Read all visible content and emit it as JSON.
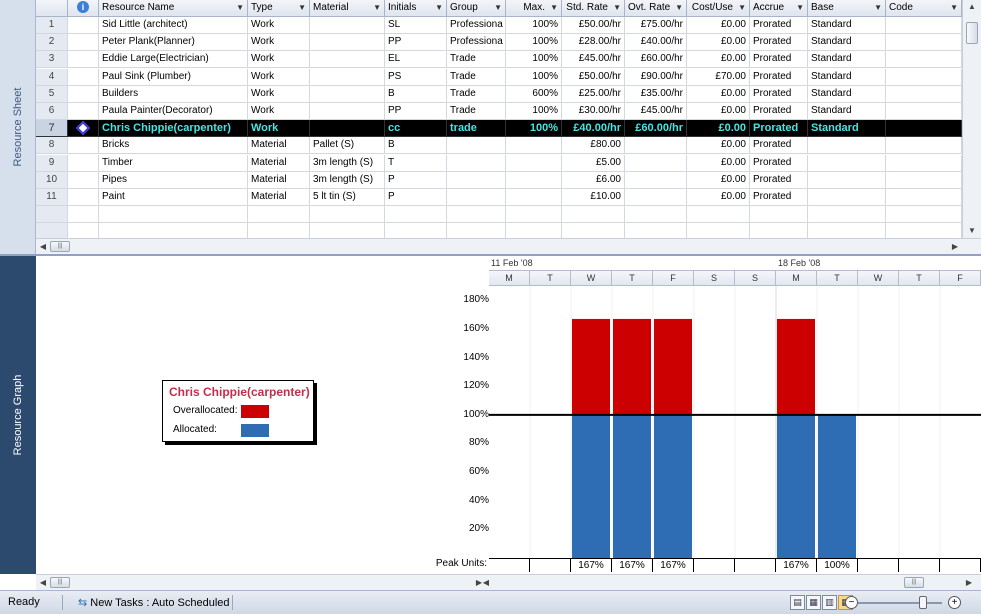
{
  "sheet": {
    "sidebar_label": "Resource Sheet",
    "columns": [
      {
        "key": "num",
        "label": ""
      },
      {
        "key": "ind",
        "label": "i-icon"
      },
      {
        "key": "name",
        "label": "Resource Name"
      },
      {
        "key": "type",
        "label": "Type"
      },
      {
        "key": "material",
        "label": "Material"
      },
      {
        "key": "initials",
        "label": "Initials"
      },
      {
        "key": "group",
        "label": "Group"
      },
      {
        "key": "max",
        "label": "Max."
      },
      {
        "key": "std",
        "label": "Std. Rate"
      },
      {
        "key": "ovt",
        "label": "Ovt. Rate"
      },
      {
        "key": "cost",
        "label": "Cost/Use"
      },
      {
        "key": "accrue",
        "label": "Accrue"
      },
      {
        "key": "base",
        "label": "Base"
      },
      {
        "key": "code",
        "label": "Code"
      }
    ],
    "rows": [
      {
        "num": "1",
        "name": "Sid Little (architect)",
        "type": "Work",
        "material": "",
        "initials": "SL",
        "group": "Professiona",
        "max": "100%",
        "std": "£50.00/hr",
        "ovt": "£75.00/hr",
        "cost": "£0.00",
        "accrue": "Prorated",
        "base": "Standard",
        "code": ""
      },
      {
        "num": "2",
        "name": "Peter Plank(Planner)",
        "type": "Work",
        "material": "",
        "initials": "PP",
        "group": "Professiona",
        "max": "100%",
        "std": "£28.00/hr",
        "ovt": "£40.00/hr",
        "cost": "£0.00",
        "accrue": "Prorated",
        "base": "Standard",
        "code": ""
      },
      {
        "num": "3",
        "name": "Eddie Large(Electrician)",
        "type": "Work",
        "material": "",
        "initials": "EL",
        "group": "Trade",
        "max": "100%",
        "std": "£45.00/hr",
        "ovt": "£60.00/hr",
        "cost": "£0.00",
        "accrue": "Prorated",
        "base": "Standard",
        "code": ""
      },
      {
        "num": "4",
        "name": "Paul Sink (Plumber)",
        "type": "Work",
        "material": "",
        "initials": "PS",
        "group": "Trade",
        "max": "100%",
        "std": "£50.00/hr",
        "ovt": "£90.00/hr",
        "cost": "£70.00",
        "accrue": "Prorated",
        "base": "Standard",
        "code": ""
      },
      {
        "num": "5",
        "name": "Builders",
        "type": "Work",
        "material": "",
        "initials": "B",
        "group": "Trade",
        "max": "600%",
        "std": "£25.00/hr",
        "ovt": "£35.00/hr",
        "cost": "£0.00",
        "accrue": "Prorated",
        "base": "Standard",
        "code": ""
      },
      {
        "num": "6",
        "name": "Paula Painter(Decorator)",
        "type": "Work",
        "material": "",
        "initials": "PP",
        "group": "Trade",
        "max": "100%",
        "std": "£30.00/hr",
        "ovt": "£45.00/hr",
        "cost": "£0.00",
        "accrue": "Prorated",
        "base": "Standard",
        "code": ""
      },
      {
        "num": "7",
        "name": "Chris Chippie(carpenter)",
        "type": "Work",
        "material": "",
        "initials": "cc",
        "group": "trade",
        "max": "100%",
        "std": "£40.00/hr",
        "ovt": "£60.00/hr",
        "cost": "£0.00",
        "accrue": "Prorated",
        "base": "Standard",
        "code": "",
        "selected": true
      },
      {
        "num": "8",
        "name": "Bricks",
        "type": "Material",
        "material": "Pallet (S)",
        "initials": "B",
        "group": "",
        "max": "",
        "std": "£80.00",
        "ovt": "",
        "cost": "£0.00",
        "accrue": "Prorated",
        "base": "",
        "code": ""
      },
      {
        "num": "9",
        "name": "Timber",
        "type": "Material",
        "material": "3m length (S)",
        "initials": "T",
        "group": "",
        "max": "",
        "std": "£5.00",
        "ovt": "",
        "cost": "£0.00",
        "accrue": "Prorated",
        "base": "",
        "code": ""
      },
      {
        "num": "10",
        "name": "Pipes",
        "type": "Material",
        "material": "3m length (S)",
        "initials": "P",
        "group": "",
        "max": "",
        "std": "£6.00",
        "ovt": "",
        "cost": "£0.00",
        "accrue": "Prorated",
        "base": "",
        "code": ""
      },
      {
        "num": "11",
        "name": "Paint",
        "type": "Material",
        "material": "5 lt tin (S)",
        "initials": "P",
        "group": "",
        "max": "",
        "std": "£10.00",
        "ovt": "",
        "cost": "£0.00",
        "accrue": "Prorated",
        "base": "",
        "code": ""
      }
    ]
  },
  "graph": {
    "sidebar_label": "Resource Graph",
    "legend": {
      "title": "Chris Chippie(carpenter)",
      "overallocated_label": "Overallocated:",
      "allocated_label": "Allocated:",
      "overallocated_color": "#cc0000",
      "allocated_color": "#2e6db4"
    },
    "timescale": {
      "weeks": [
        "11 Feb '08",
        "18 Feb '08"
      ],
      "days": [
        "M",
        "T",
        "W",
        "T",
        "F",
        "S",
        "S",
        "M",
        "T",
        "W",
        "T",
        "F"
      ]
    },
    "peak_units_label": "Peak Units:"
  },
  "chart_data": {
    "type": "bar",
    "title": "",
    "xlabel": "",
    "ylabel": "",
    "ylim": [
      0,
      190
    ],
    "yticks": [
      "20%",
      "40%",
      "60%",
      "80%",
      "100%",
      "120%",
      "140%",
      "160%",
      "180%"
    ],
    "threshold": 100,
    "categories": [
      "M",
      "T",
      "W",
      "T",
      "F",
      "S",
      "S",
      "M",
      "T",
      "W",
      "T",
      "F"
    ],
    "series": [
      {
        "name": "Allocated:",
        "values": [
          0,
          0,
          100,
          100,
          100,
          0,
          0,
          100,
          100,
          0,
          0,
          0
        ]
      },
      {
        "name": "Overallocated:",
        "values": [
          0,
          0,
          67,
          67,
          67,
          0,
          0,
          67,
          0,
          0,
          0,
          0
        ]
      }
    ],
    "peak_units": [
      "",
      "",
      "167%",
      "167%",
      "167%",
      "",
      "",
      "167%",
      "100%",
      "",
      "",
      ""
    ]
  },
  "status": {
    "ready": "Ready",
    "new_tasks": "New Tasks : Auto Scheduled"
  }
}
